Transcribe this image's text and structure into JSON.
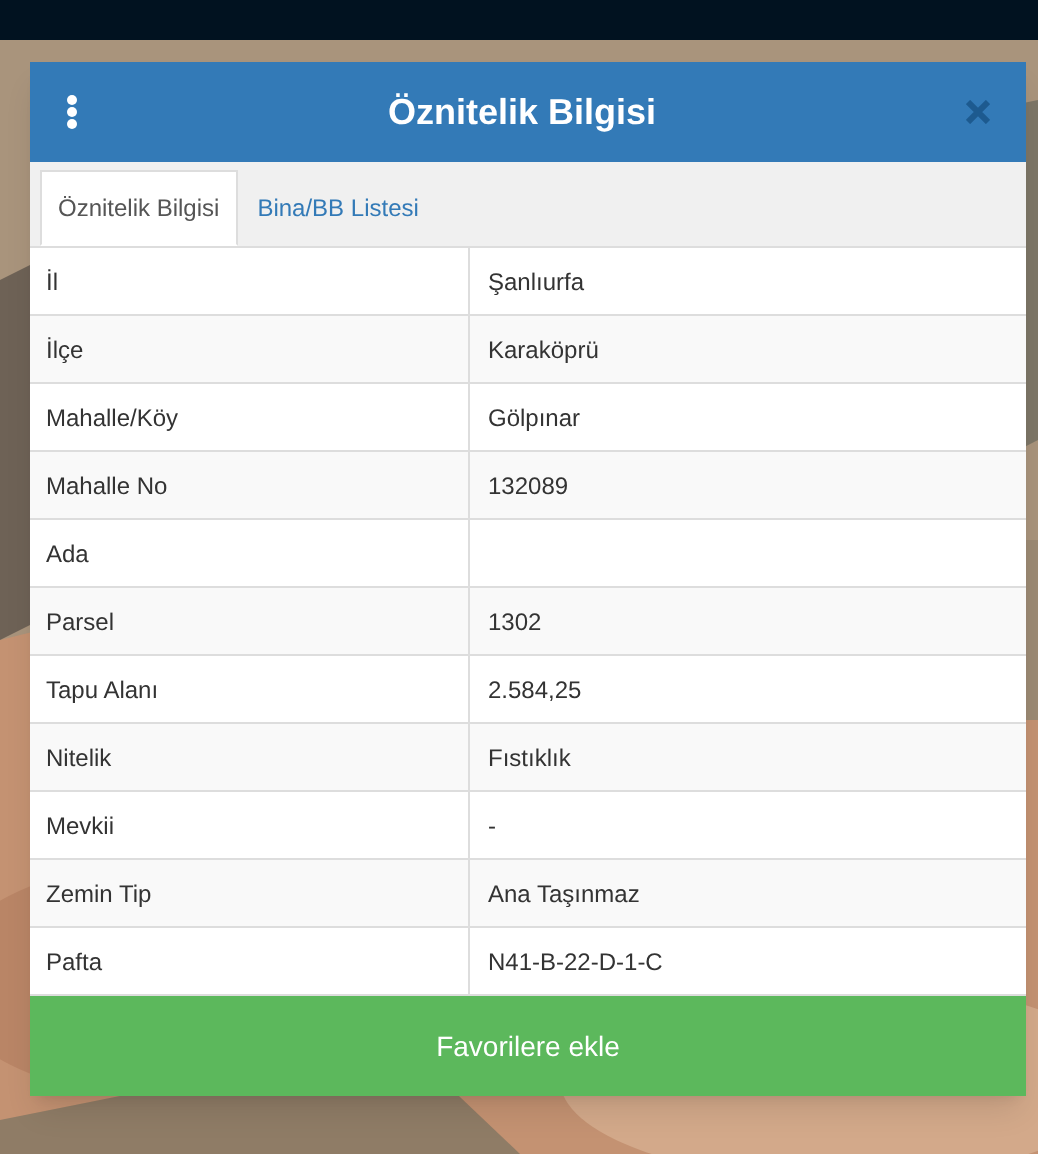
{
  "dialog": {
    "title": "Öznitelik Bilgisi"
  },
  "tabs": [
    {
      "label": "Öznitelik Bilgisi",
      "selected": true
    },
    {
      "label": "Bina/BB Listesi",
      "selected": false
    }
  ],
  "rows": [
    {
      "label": "İl",
      "value": "Şanlıurfa"
    },
    {
      "label": "İlçe",
      "value": "Karaköprü"
    },
    {
      "label": "Mahalle/Köy",
      "value": "Gölpınar"
    },
    {
      "label": "Mahalle No",
      "value": "132089"
    },
    {
      "label": "Ada",
      "value": null
    },
    {
      "label": "Parsel",
      "value": "1302"
    },
    {
      "label": "Tapu Alanı",
      "value": "2.584,25"
    },
    {
      "label": "Nitelik",
      "value": "Fıstıklık"
    },
    {
      "label": "Mevkii",
      "value": "-"
    },
    {
      "label": "Zemin Tip",
      "value": "Ana Taşınmaz"
    },
    {
      "label": "Pafta",
      "value": "N41-B-22-D-1-C"
    }
  ],
  "button": "Favorilere ekle"
}
